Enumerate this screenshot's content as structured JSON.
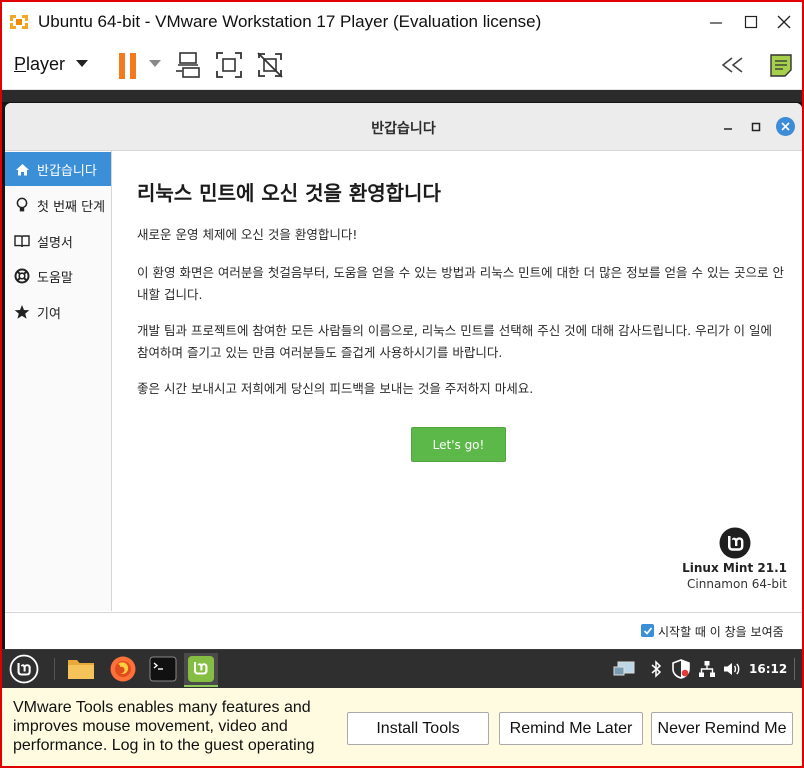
{
  "window": {
    "title": "Ubuntu 64-bit - VMware Workstation 17 Player (Evaluation license)",
    "controls": {
      "minimize": "minimize-icon",
      "maximize": "maximize-icon",
      "close": "close-icon"
    }
  },
  "toolbar": {
    "player_menu_accel": "P",
    "player_menu_rest": "layer",
    "buttons": [
      "pause-icon",
      "send-ctrl-alt-del-icon",
      "full-screen-icon",
      "unity-icon"
    ],
    "right_buttons": [
      "collapse-toolbar-icon",
      "message-log-icon"
    ]
  },
  "welcome": {
    "window_title": "반갑습니다",
    "sidebar": [
      {
        "label": "반갑습니다",
        "icon": "home-icon",
        "active": true
      },
      {
        "label": "첫 번째 단계",
        "icon": "lightbulb-icon",
        "active": false
      },
      {
        "label": "설명서",
        "icon": "book-icon",
        "active": false
      },
      {
        "label": "도움말",
        "icon": "lifebuoy-icon",
        "active": false
      },
      {
        "label": "기여",
        "icon": "star-icon",
        "active": false
      }
    ],
    "heading": "리눅스 민트에 오신 것을 환영합니다",
    "paragraphs": [
      "새로운 운영 체제에 오신 것을 환영합니다!",
      "이 환영 화면은 여러분을 첫걸음부터, 도움을 얻을 수 있는 방법과 리눅스 민트에 대한 더 많은 정보를 얻을 수 있는 곳으로 안내할 겁니다.",
      "개발 팀과 프로젝트에 참여한 모든 사람들의 이름으로, 리눅스 민트를 선택해 주신 것에 대해 감사드립니다. 우리가 이 일에 참여하며 즐기고 있는 만큼 여러분들도 즐겁게 사용하시기를 바랍니다.",
      "좋은 시간 보내시고 저희에게 당신의 피드백을 보내는 것을 주저하지 마세요."
    ],
    "go_button": "Let's go!",
    "version_name": "Linux Mint 21.1",
    "version_edition": "Cinnamon 64-bit",
    "startup_checkbox": {
      "label": "시작할 때 이 창을 보여줌",
      "checked": true
    }
  },
  "panel": {
    "launchers": [
      "mint-menu-icon",
      "files-icon",
      "firefox-icon",
      "terminal-icon",
      "welcome-app-icon"
    ],
    "tray": [
      "display-icon",
      "bluetooth-icon",
      "shield-icon",
      "network-icon",
      "volume-icon"
    ],
    "clock": "16:12"
  },
  "tools_bar": {
    "message": "VMware Tools enables many features and improves mouse movement, video and performance. Log in to the guest operating",
    "install": "Install Tools",
    "remind_later": "Remind Me Later",
    "never_remind": "Never Remind Me"
  },
  "colors": {
    "accent_blue": "#3a8fd6",
    "go_green": "#5db84a",
    "vmware_pause": "#f47a20",
    "tools_bar_bg": "#fffbe0",
    "frame_red": "#e00000"
  }
}
